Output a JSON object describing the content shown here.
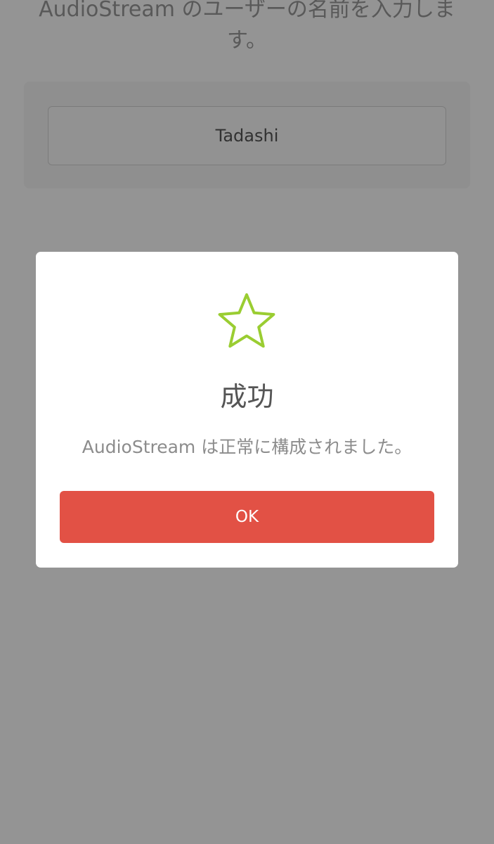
{
  "background": {
    "prompt": "AudioStream のユーザーの名前を入力します。",
    "name_input_value": "Tadashi"
  },
  "dialog": {
    "icon": "star-outline-icon",
    "icon_color": "#9acd32",
    "title": "成功",
    "message": "AudioStream は正常に構成されました。",
    "ok_label": "OK",
    "ok_color": "#e25145"
  },
  "colors": {
    "overlay": "rgba(0,0,0,0.42)",
    "dialog_background": "#ffffff"
  }
}
